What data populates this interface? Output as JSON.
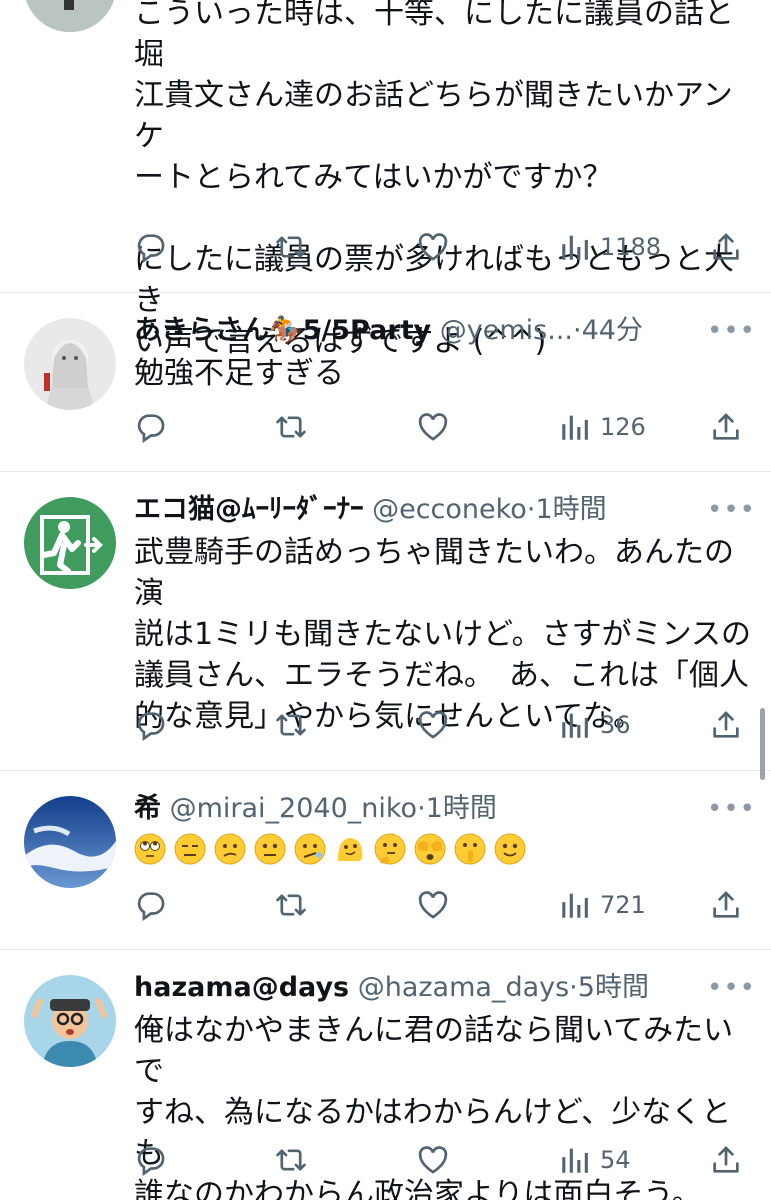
{
  "colors": {
    "text": "#0f1419",
    "muted": "#536471",
    "divider": "#e6e9eb"
  },
  "tweets": [
    {
      "body": "こういった時は、十等、にしたに議員の話と堀\n江貴文さん達のお話どちらが聞きたいかアンケ\nートとられてみてはいかがですか？\n\nにしたに議員の票が多ければもっともっと大き\nい声で言えるはずですよ (^^)",
      "views": "1188"
    },
    {
      "name": "あきらさん🏇5/5Party",
      "handle": "@yemis...",
      "dot": "·",
      "time": "44分",
      "body": "勉強不足すぎる",
      "views": "126",
      "avatar": "girl-avatar"
    },
    {
      "name": "エコ猫@ﾑｰﾘｰﾀﾞｰﾅｰ",
      "handle": "@ecconeko",
      "dot": "·",
      "time": "1時間",
      "body": "武豊騎手の話めっちゃ聞きたいわ。あんたの演\n説は1ミリも聞きたないけど。さすがミンスの\n議員さん、エラそうだね。　あ、これは「個人\n的な意見」やから気にせんといてな。",
      "views": "36",
      "avatar": "exit-sign-avatar"
    },
    {
      "name": "希",
      "handle": "@mirai_2040_niko",
      "dot": "·",
      "time": "1時間",
      "emojis": [
        "face-with-rolling-eyes",
        "expressionless-face",
        "confused-face",
        "neutral-face",
        "face-with-diagonal-mouth",
        "melting-face",
        "thinking-face",
        "face-with-hands-over-eyes",
        "shushing-face",
        "slightly-smiling-face"
      ],
      "views": "721",
      "avatar": "sky-avatar"
    },
    {
      "name": "hazama@days",
      "handle": "@hazama_days",
      "dot": "·",
      "time": "5時間",
      "body": "俺はなかやまきんに君の話なら聞いてみたいで\nすね、為になるかはわからんけど、少なくとも\n誰なのかわからん政治家よりは面白そう。",
      "views": "54",
      "avatar": "cartoon-man-avatar"
    }
  ],
  "icons": {
    "reply": "reply-icon",
    "retweet": "retweet-icon",
    "like": "heart-icon",
    "views": "views-icon",
    "share": "share-icon",
    "more": "more-icon"
  }
}
